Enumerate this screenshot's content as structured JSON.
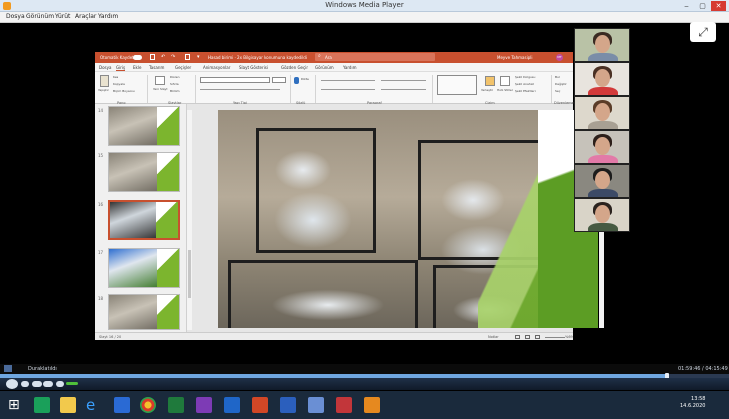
{
  "window": {
    "title": "Windows Media Player",
    "controls": [
      "‒",
      "▢",
      "✕"
    ]
  },
  "menu": [
    "Dosya",
    "Görünüm",
    "Yürüt",
    "Araçlar",
    "Yardım"
  ],
  "expand_icon": "expand-icon",
  "ppt": {
    "autosave_label": "Otomatik Kaydet",
    "filename": "Hasad birimi · 2x Bilgisayar konumuna kaydedildi",
    "search": "Ara",
    "user": "Meyve Tahmasipli",
    "user_initials": "MT",
    "tabs": [
      "Dosya",
      "Giriş",
      "Ekle",
      "Tasarım",
      "Geçişler",
      "Animasyonlar",
      "Slayt Gösterisi",
      "Gözden Geçir",
      "Görünüm",
      "Yardım"
    ],
    "ribbon_groups": [
      "Pano",
      "Slaytlar",
      "Yazı Tipi",
      "Sözlü",
      "Paragraf",
      "Çizim",
      "Düzenleme"
    ],
    "ribbon": {
      "paste": "Yapıştır",
      "cut": "Kes",
      "copy": "Kopyala",
      "format_painter": "Biçim Boyacısı",
      "new_slide": "Yeni Slayt",
      "layout": "Düzen",
      "reset": "Sıfırla",
      "section": "Bölüm",
      "dictate": "Dikte",
      "shape_fill": "Şekil Dolgusu",
      "shape_outline": "Şekil Anahat",
      "shape_effects": "Şekil Efektleri",
      "find": "Bul",
      "replace": "Değiştir",
      "select": "Seç",
      "quick_styles": "Hızlı Stiller",
      "arrange": "Yerleştir"
    },
    "thumb_numbers": [
      "14",
      "15",
      "16",
      "17",
      "18"
    ],
    "status_left": "Slayt 16 / 20",
    "notes": "Notlar",
    "zoom": "%69"
  },
  "wmp": {
    "status": "Duraklatıldı",
    "time": "01:59:46 / 04:15:49",
    "progress": 0.915
  },
  "taskbar": {
    "clock_time": "13:58",
    "clock_date": "14.6.2020"
  }
}
